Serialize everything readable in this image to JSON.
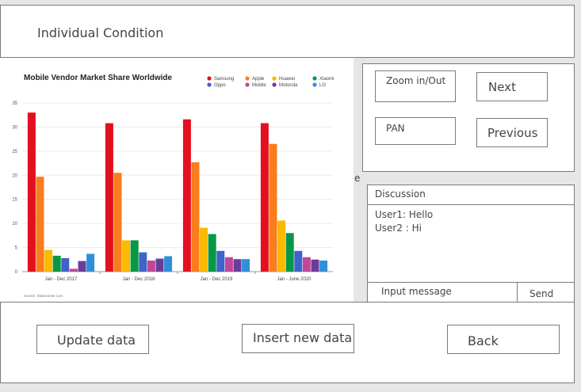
{
  "header": {
    "title": "Individual Condition"
  },
  "controls": {
    "zoom": "Zoom in/Out",
    "next": "Next",
    "pan": "PAN",
    "previous": "Previous"
  },
  "stray_text": "e",
  "discussion": {
    "title": "Discussion",
    "messages": [
      "User1: Hello",
      "User2 : Hi"
    ],
    "input_placeholder": "Input message",
    "send": "Send"
  },
  "footer": {
    "update": "Update data",
    "insert": "Insert new data",
    "back": "Back"
  },
  "chart_data": {
    "type": "bar",
    "title": "Mobile Vendor Market Share Worldwide",
    "source": "Source: Statcounter.com",
    "categories": [
      "Jan - Dec 2017",
      "Jan - Dec 2018",
      "Jan - Dec 2019",
      "Jan - June 2020"
    ],
    "ylim": [
      0,
      35
    ],
    "yticks": [
      0,
      5,
      10,
      15,
      20,
      25,
      30,
      35
    ],
    "grid": true,
    "legend_position": "top-right",
    "series": [
      {
        "name": "Samsung",
        "color": "#e3101f",
        "values": [
          33.0,
          30.8,
          31.6,
          30.8
        ]
      },
      {
        "name": "Apple",
        "color": "#f97c1d",
        "values": [
          19.7,
          20.5,
          22.7,
          26.5
        ]
      },
      {
        "name": "Huawei",
        "color": "#fcb900",
        "values": [
          4.5,
          6.5,
          9.1,
          10.6
        ]
      },
      {
        "name": "Xiaomi",
        "color": "#079846",
        "values": [
          3.3,
          6.5,
          7.8,
          8.0
        ]
      },
      {
        "name": "Oppo",
        "color": "#3f63c7",
        "values": [
          2.8,
          4.0,
          4.3,
          4.3
        ]
      },
      {
        "name": "Mobile",
        "color": "#c0479a",
        "values": [
          0.6,
          2.3,
          3.0,
          3.0
        ]
      },
      {
        "name": "Motorola",
        "color": "#6a3d9a",
        "values": [
          2.2,
          2.7,
          2.6,
          2.5
        ]
      },
      {
        "name": "LG",
        "color": "#2e91d8",
        "values": [
          3.7,
          3.2,
          2.6,
          2.3
        ]
      }
    ]
  }
}
